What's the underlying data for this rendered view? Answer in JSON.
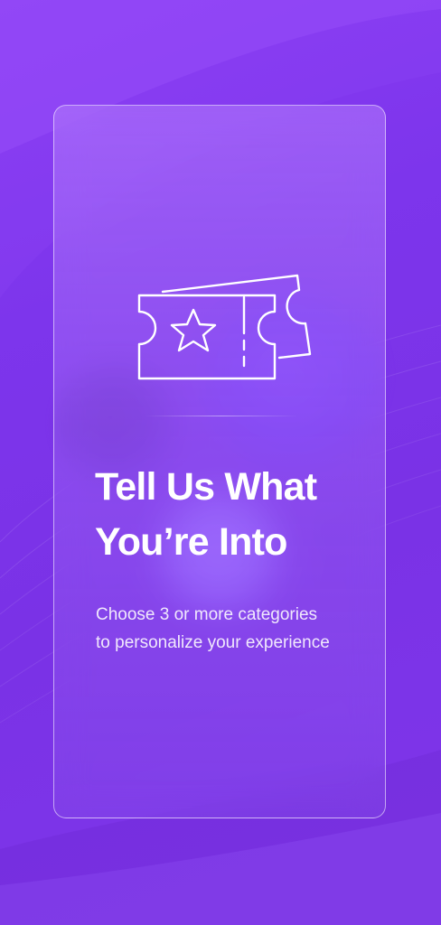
{
  "screen": {
    "title_line1": "Tell Us What",
    "title_line2": "You’re Into",
    "subtitle_line1": "Choose 3 or more categories",
    "subtitle_line2": "to personalize your experience"
  },
  "icons": {
    "hero": "ticket-star-icon"
  },
  "colors": {
    "background": "#7e36ea",
    "card_border": "#ffffff",
    "text": "#ffffff"
  }
}
